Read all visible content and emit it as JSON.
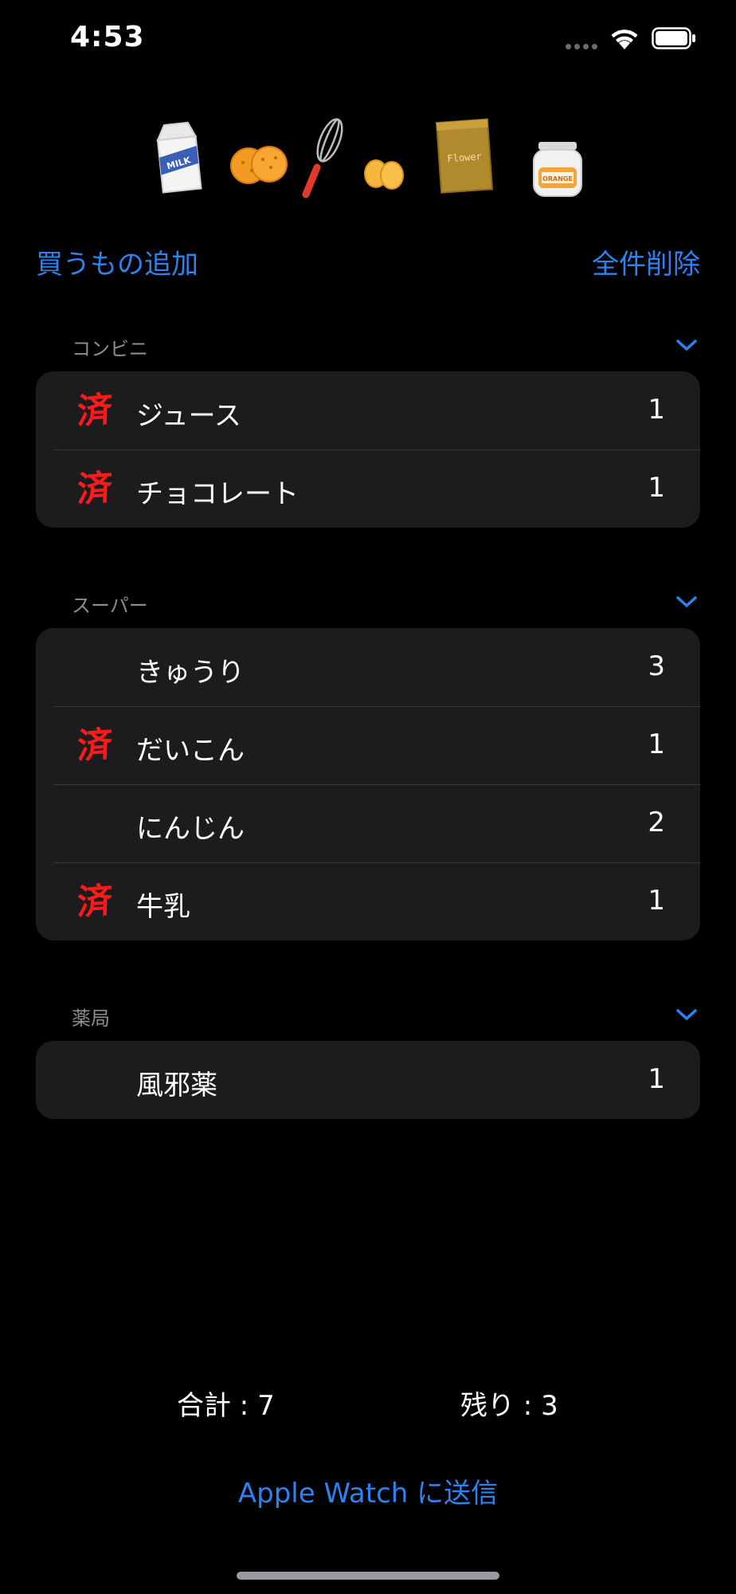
{
  "status_bar": {
    "time": "4:53"
  },
  "illustration": {
    "icons": [
      "milk-carton-icon",
      "crackers-icon",
      "whisk-icon",
      "eggs-icon",
      "flour-bag-icon",
      "orange-jar-icon"
    ],
    "milk_label": "MILK",
    "flour_label": "Flower",
    "jar_label": "ORANGE"
  },
  "toolbar": {
    "add_label": "買うもの追加",
    "delete_all_label": "全件削除"
  },
  "done_mark": "済",
  "sections": [
    {
      "title": "コンビニ",
      "items": [
        {
          "name": "ジュース",
          "qty": "1",
          "done": true
        },
        {
          "name": "チョコレート",
          "qty": "1",
          "done": true
        }
      ]
    },
    {
      "title": "スーパー",
      "items": [
        {
          "name": "きゅうり",
          "qty": "3",
          "done": false
        },
        {
          "name": "だいこん",
          "qty": "1",
          "done": true
        },
        {
          "name": "にんじん",
          "qty": "2",
          "done": false
        },
        {
          "name": "牛乳",
          "qty": "1",
          "done": true
        }
      ]
    },
    {
      "title": "薬局",
      "items": [
        {
          "name": "風邪薬",
          "qty": "1",
          "done": false
        }
      ]
    }
  ],
  "summary": {
    "total_label": "合計 : 7",
    "remaining_label": "残り : 3"
  },
  "send_button_label": "Apple Watch に送信",
  "colors": {
    "accent": "#2b83f2",
    "done_mark": "#ff1a1a",
    "card_background": "#1c1c1e",
    "background": "#000000"
  }
}
